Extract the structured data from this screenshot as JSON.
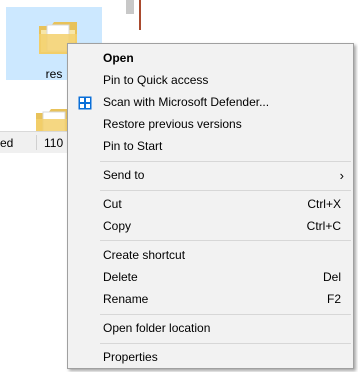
{
  "explorer": {
    "folder_label": "res",
    "status_left": "ed",
    "status_count": "110 i"
  },
  "menu": {
    "items": [
      {
        "label": "Open",
        "bold": true
      },
      {
        "label": "Pin to Quick access"
      },
      {
        "label": "Scan with Microsoft Defender...",
        "icon": "defender-shield-icon"
      },
      {
        "label": "Restore previous versions"
      },
      {
        "label": "Pin to Start"
      },
      {
        "label": "Send to",
        "submenu": true
      },
      {
        "label": "Cut",
        "shortcut": "Ctrl+X"
      },
      {
        "label": "Copy",
        "shortcut": "Ctrl+C"
      },
      {
        "label": "Create shortcut"
      },
      {
        "label": "Delete",
        "shortcut": "Del"
      },
      {
        "label": "Rename",
        "shortcut": "F2"
      },
      {
        "label": "Open folder location"
      },
      {
        "label": "Properties"
      }
    ],
    "submenu_arrow": "›"
  },
  "colors": {
    "selection": "#cce8ff",
    "menu_bg": "#f2f2f2",
    "defender_blue": "#0a6fd8"
  }
}
